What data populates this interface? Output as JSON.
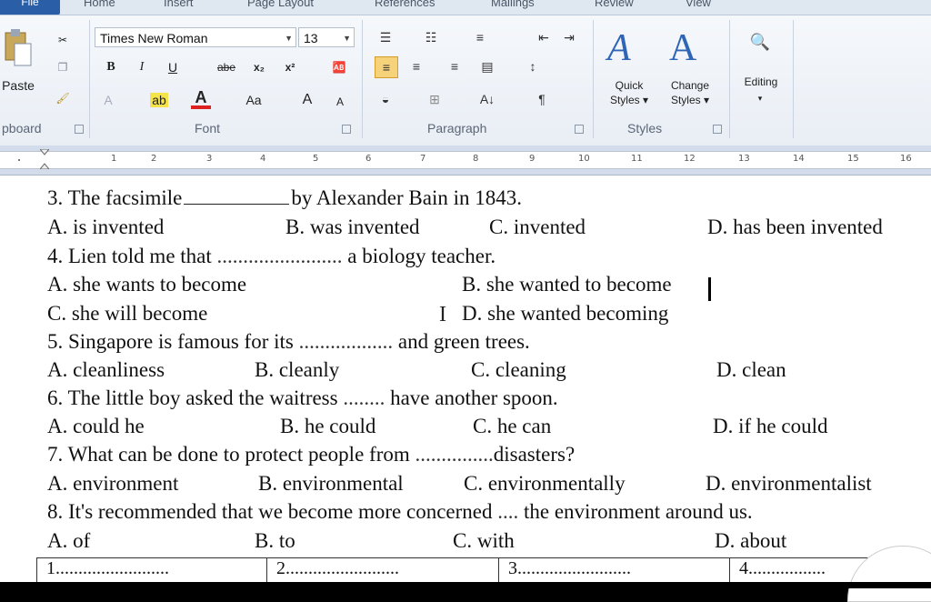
{
  "ribbon": {
    "tabs": [
      "File",
      "Home",
      "Insert",
      "Page Layout",
      "References",
      "Mailings",
      "Review",
      "View"
    ],
    "clipboard": {
      "paste": "Paste",
      "label": "pboard"
    },
    "font": {
      "name": "Times New Roman",
      "size": "13",
      "label": "Font",
      "aa": "Aa",
      "grow": "A",
      "shrink": "A",
      "bold": "B",
      "italic": "I",
      "underline": "U",
      "strike": "abe",
      "sub": "x₂",
      "sup": "x²"
    },
    "paragraph": {
      "label": "Paragraph",
      "sort": "A↓",
      "pilcrow": "¶"
    },
    "styles": {
      "quick": "Quick\nStyles",
      "quick1": "Quick",
      "quick2": "Styles ▾",
      "change1": "Change",
      "change2": "Styles ▾",
      "label": "Styles"
    },
    "editing": {
      "label": "Editing"
    }
  },
  "ruler": {
    "numbers": [
      "1",
      "2",
      "3",
      "4",
      "5",
      "6",
      "7",
      "8",
      "9",
      "10",
      "11",
      "12",
      "13",
      "14",
      "15",
      "16"
    ]
  },
  "questions": [
    {
      "stem_pre": "3. The facsimile",
      "stem_post": "by Alexander Bain in 1843.",
      "options": [
        "A. is invented",
        "B. was invented",
        "C. invented",
        "D. has been invented"
      ]
    },
    {
      "stem_pre": "4. Lien told me that",
      "blank": "........................",
      "stem_post": "a biology teacher.",
      "options": [
        "A. she wants to become",
        "B. she wanted to become",
        "C. she will become",
        "D. she wanted becoming"
      ]
    },
    {
      "stem_pre": "5. Singapore is famous for its",
      "blank": "..................",
      "stem_post": "and green trees.",
      "options": [
        "A. cleanliness",
        "B. cleanly",
        "C. cleaning",
        "D. clean"
      ]
    },
    {
      "stem_pre": "6. The little boy asked the waitress",
      "blank": "........",
      "stem_post": "have another spoon.",
      "options": [
        "A. could he",
        "B. he could",
        "C. he can",
        "D. if he could"
      ]
    },
    {
      "stem_pre": "7. What can be done to protect people from",
      "blank": "...............",
      "stem_post": "disasters?",
      "options": [
        "A. environment",
        "B. environmental",
        "C. environmentally",
        "D. environmentalist"
      ]
    },
    {
      "stem_pre": "8. It's recommended that we become more concerned",
      "blank": "....",
      "stem_post": "the environment around us.",
      "options": [
        "A. of",
        "B. to",
        "C. with",
        "D. about"
      ]
    }
  ],
  "answer_table": [
    "1.........................",
    "2.........................",
    "3.........................",
    "4................."
  ],
  "colors": {
    "file_tab": "#2a5fa8",
    "ribbon_bg": "#eef2f8",
    "ruler_bg": "#d3dceb"
  }
}
